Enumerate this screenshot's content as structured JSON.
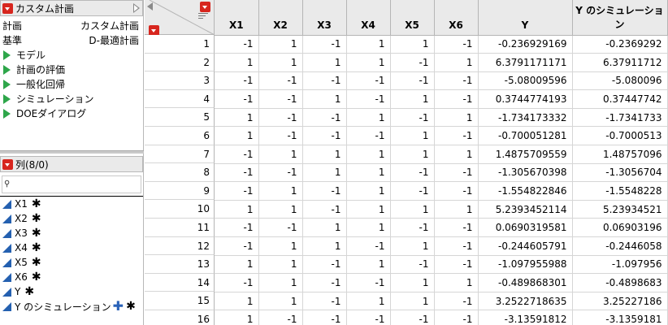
{
  "table_panel": {
    "title": "カスタム計画",
    "info": [
      {
        "label": "計画",
        "value": "カスタム計画"
      },
      {
        "label": "基準",
        "value": "D-最適計画"
      }
    ],
    "scripts": [
      "モデル",
      "計画の評価",
      "一般化回帰",
      "シミュレーション",
      "DOEダイアログ"
    ]
  },
  "columns_panel": {
    "title": "列(8/0)",
    "search_placeholder": "",
    "columns": [
      {
        "name": "X1",
        "marker": "✱"
      },
      {
        "name": "X2",
        "marker": "✱"
      },
      {
        "name": "X3",
        "marker": "✱"
      },
      {
        "name": "X4",
        "marker": "✱"
      },
      {
        "name": "X5",
        "marker": "✱"
      },
      {
        "name": "X6",
        "marker": "✱"
      },
      {
        "name": "Y",
        "marker": "✱"
      },
      {
        "name": "Y のシミュレーション",
        "marker": "✱",
        "formula_icon": "plus-icon"
      }
    ]
  },
  "data_table": {
    "headers": [
      "X1",
      "X2",
      "X3",
      "X4",
      "X5",
      "X6",
      "Y",
      "Y のシミュレーション"
    ],
    "rows": [
      [
        "1",
        "-1",
        "1",
        "-1",
        "1",
        "1",
        "-1",
        "-0.236929169",
        "-0.2369292"
      ],
      [
        "2",
        "1",
        "1",
        "1",
        "1",
        "-1",
        "1",
        "6.3791171171",
        "6.37911712"
      ],
      [
        "3",
        "-1",
        "-1",
        "-1",
        "-1",
        "-1",
        "-1",
        "-5.08009596",
        "-5.080096"
      ],
      [
        "4",
        "-1",
        "-1",
        "1",
        "-1",
        "1",
        "-1",
        "0.3744774193",
        "0.37447742"
      ],
      [
        "5",
        "1",
        "-1",
        "-1",
        "1",
        "-1",
        "1",
        "-1.734173332",
        "-1.7341733"
      ],
      [
        "6",
        "1",
        "-1",
        "-1",
        "-1",
        "1",
        "-1",
        "-0.700051281",
        "-0.7000513"
      ],
      [
        "7",
        "-1",
        "1",
        "1",
        "1",
        "1",
        "1",
        "1.4875709559",
        "1.48757096"
      ],
      [
        "8",
        "-1",
        "-1",
        "1",
        "1",
        "-1",
        "-1",
        "-1.305670398",
        "-1.3056704"
      ],
      [
        "9",
        "-1",
        "1",
        "-1",
        "1",
        "-1",
        "-1",
        "-1.554822846",
        "-1.5548228"
      ],
      [
        "10",
        "1",
        "1",
        "-1",
        "1",
        "1",
        "1",
        "5.2393452114",
        "5.23934521"
      ],
      [
        "11",
        "-1",
        "-1",
        "1",
        "1",
        "-1",
        "-1",
        "0.0690319581",
        "0.06903196"
      ],
      [
        "12",
        "-1",
        "1",
        "1",
        "-1",
        "1",
        "-1",
        "-0.244605791",
        "-0.2446058"
      ],
      [
        "13",
        "1",
        "1",
        "-1",
        "1",
        "-1",
        "-1",
        "-1.097955988",
        "-1.097956"
      ],
      [
        "14",
        "-1",
        "1",
        "-1",
        "-1",
        "1",
        "1",
        "-0.489868301",
        "-0.4898683"
      ],
      [
        "15",
        "1",
        "1",
        "-1",
        "1",
        "1",
        "-1",
        "3.2522718635",
        "3.25227186"
      ],
      [
        "16",
        "1",
        "-1",
        "-1",
        "-1",
        "-1",
        "-1",
        "-3.13591812",
        "-3.1359181"
      ]
    ]
  },
  "colors": {
    "panel_header_bg": "#eaeaea",
    "red_button": "#d7261e",
    "script_play": "#2ea64a",
    "column_icon": "#2460b0"
  }
}
